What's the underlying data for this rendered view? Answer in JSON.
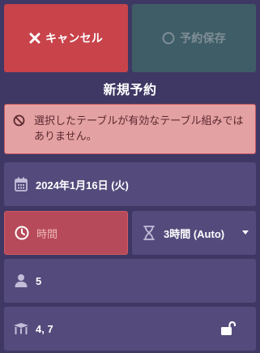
{
  "buttons": {
    "cancel_label": "キャンセル",
    "save_label": "予約保存"
  },
  "title": "新規予約",
  "alert": {
    "message": "選択したテーブルが有効なテーブル組みではありません。"
  },
  "fields": {
    "date": "2024年1月16日 (火)",
    "time_placeholder": "時間",
    "duration": "3時間 (Auto)",
    "people": "5",
    "tables": "4, 7"
  },
  "icons": {
    "cancel": "close-icon",
    "save": "circle-icon",
    "alert": "block-icon",
    "date": "calendar-icon",
    "time": "clock-icon",
    "duration": "hourglass-icon",
    "people": "person-icon",
    "tables": "table-icon",
    "lock": "unlock-icon"
  },
  "colors": {
    "background": "#3f3864",
    "cancel": "#c8434a",
    "save_disabled": "#3f5d66",
    "field": "#544b7c",
    "alert_bg": "#e4a1a3",
    "alert_border": "#c7585f",
    "error_field": "#b64a5a"
  }
}
